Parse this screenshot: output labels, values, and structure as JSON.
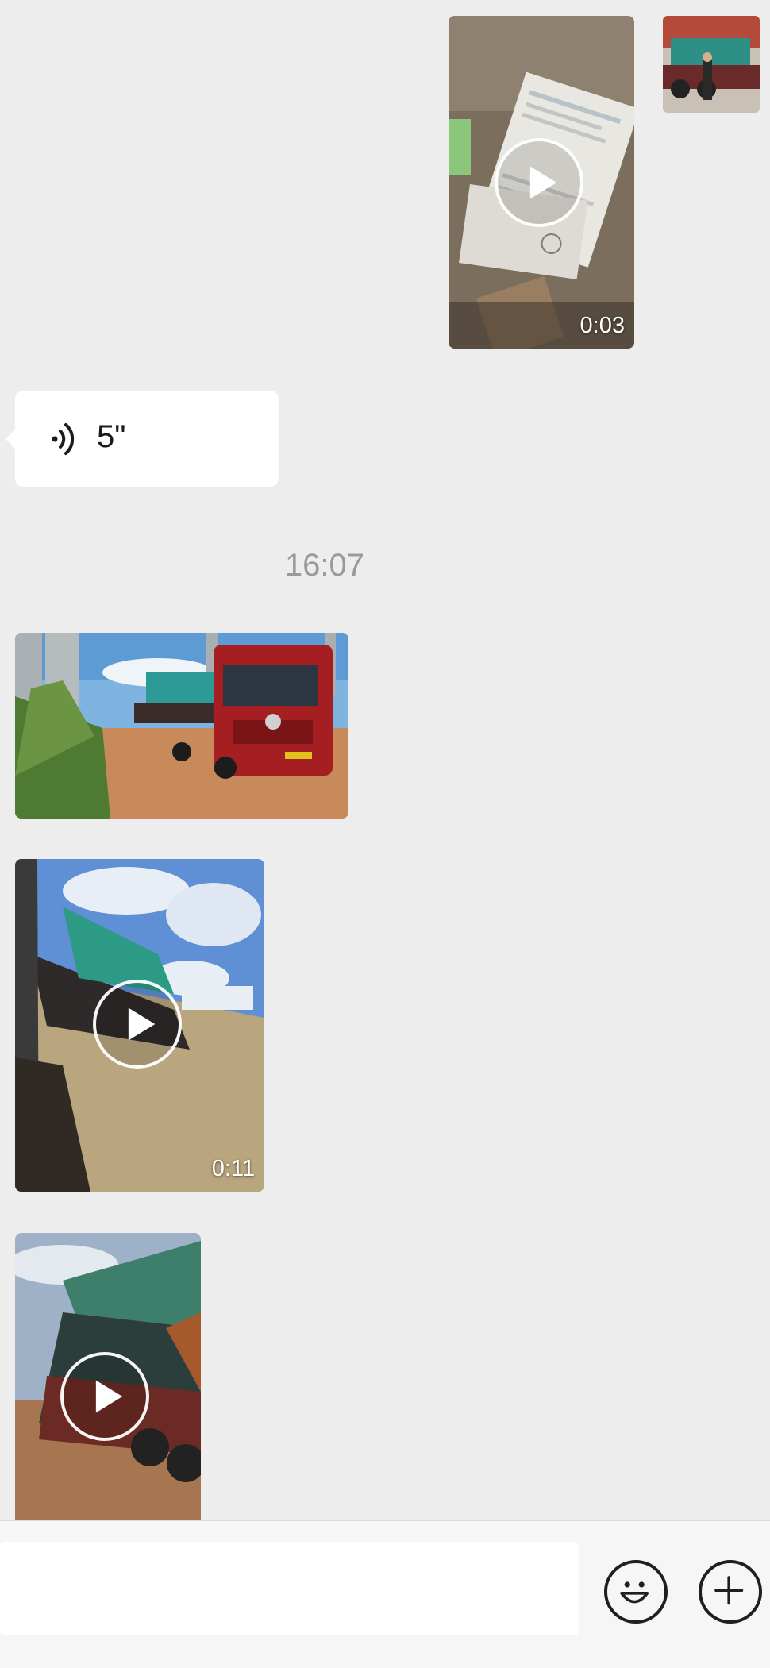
{
  "messages": {
    "video1": {
      "duration": "0:03",
      "icon": "play-icon"
    },
    "voice": {
      "length": "5\"",
      "icon": "voice-wave-icon"
    },
    "timestamp": "16:07",
    "video2": {
      "duration": "0:11",
      "icon": "play-icon"
    },
    "video3": {
      "icon": "play-icon"
    }
  },
  "input_bar": {
    "message_value": "",
    "emoji_icon": "emoji-icon",
    "more_icon": "plus-icon"
  },
  "colors": {
    "background": "#ededed",
    "bubble_white": "#ffffff",
    "timestamp_gray": "#9a9a9a"
  }
}
